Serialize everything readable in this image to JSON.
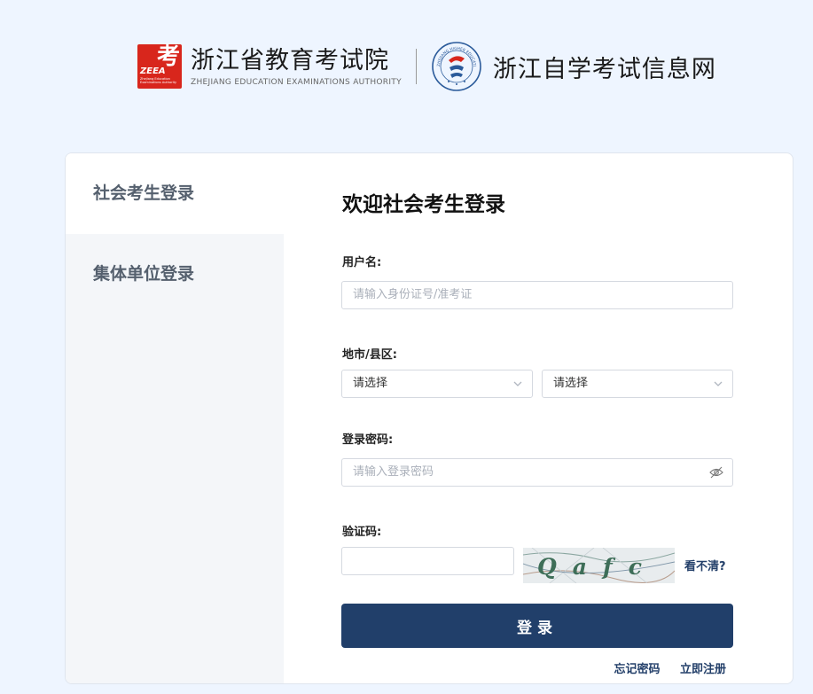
{
  "header": {
    "logo_char": "考",
    "logo_abbr": "ZEEA",
    "logo_small_text": "Zhejiang Education Examinations Authority",
    "org_name_cn": "浙江省教育考试院",
    "org_name_en": "ZHEJIANG EDUCATION EXAMINATIONS AUTHORITY",
    "emblem_text": "ZHEJIANG HIGHER EDUCATION EXAMINATIONS",
    "site_title": "浙江自学考试信息网"
  },
  "tabs": [
    {
      "label": "社会考生登录",
      "active": true
    },
    {
      "label": "集体单位登录",
      "active": false
    }
  ],
  "form": {
    "title": "欢迎社会考生登录",
    "username": {
      "label": "用户名:",
      "placeholder": "请输入身份证号/准考证"
    },
    "region": {
      "label": "地市/县区:",
      "city_value": "请选择",
      "county_value": "请选择"
    },
    "password": {
      "label": "登录密码:",
      "placeholder": "请输入登录密码"
    },
    "captcha": {
      "label": "验证码:",
      "value": "",
      "image_text": "Qafc",
      "refresh_label": "看不清?"
    },
    "submit_label": "登录",
    "forgot_label": "忘记密码",
    "register_label": "立即注册"
  },
  "colors": {
    "page_bg": "#eef5ff",
    "brand_red": "#d8261c",
    "primary": "#213f6a",
    "link": "#24406a"
  }
}
